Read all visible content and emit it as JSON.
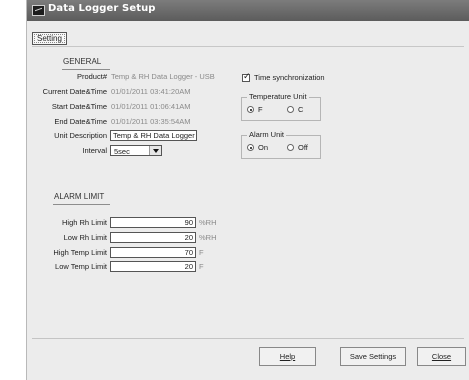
{
  "window": {
    "title": "Data Logger Setup"
  },
  "tabs": [
    {
      "label": "Setting"
    }
  ],
  "general": {
    "heading": "GENERAL",
    "product": {
      "label": "Product#",
      "value": "Temp & RH Data Logger - USB"
    },
    "current_datetime": {
      "label": "Current Date&Time",
      "value": "01/01/2011 03:41:20AM"
    },
    "start_datetime": {
      "label": "Start Date&Time",
      "value": "01/01/2011 01:06:41AM"
    },
    "end_datetime": {
      "label": "End Date&Time",
      "value": "01/01/2011 03:35:54AM"
    },
    "unit_description": {
      "label": "Unit Description",
      "value": "Temp & RH Data Logger"
    },
    "interval": {
      "label": "Interval",
      "selected": "5sec"
    }
  },
  "time_sync": {
    "label": "Time synchronization",
    "checked": true
  },
  "temperature_unit": {
    "title": "Temperature Unit",
    "options": [
      {
        "label": "F",
        "selected": true
      },
      {
        "label": "C",
        "selected": false
      }
    ]
  },
  "alarm_unit": {
    "title": "Alarm Unit",
    "options": [
      {
        "label": "On",
        "selected": true
      },
      {
        "label": "Off",
        "selected": false
      }
    ]
  },
  "alarm_limit": {
    "heading": "ALARM LIMIT",
    "rows": [
      {
        "label": "High Rh Limit",
        "value": "90",
        "unit": "%RH"
      },
      {
        "label": "Low Rh Limit",
        "value": "20",
        "unit": "%RH"
      },
      {
        "label": "High Temp Limit",
        "value": "70",
        "unit": "F"
      },
      {
        "label": "Low Temp Limit",
        "value": "20",
        "unit": "F"
      }
    ]
  },
  "buttons": {
    "help": {
      "label": "Help"
    },
    "save": {
      "label": "Save Settings"
    },
    "close": {
      "label": "Close"
    }
  },
  "colors": {
    "titlebar": "#6b6b6b",
    "window_bg": "#ececec",
    "value_grey": "#8a8a8a"
  }
}
